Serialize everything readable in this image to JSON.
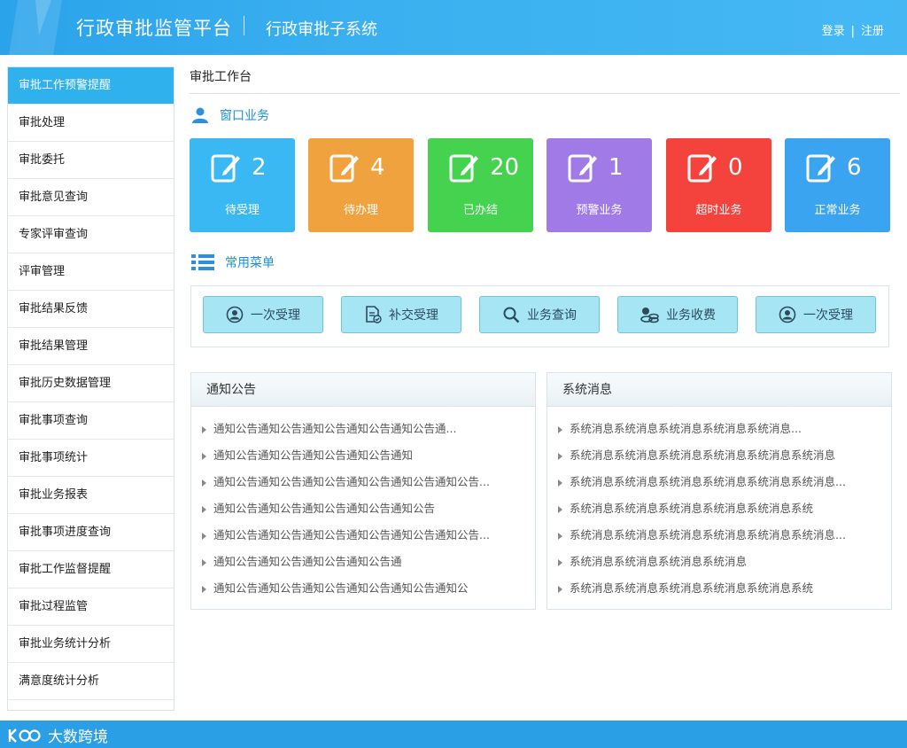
{
  "header": {
    "title": "行政审批监管平台",
    "subtitle": "行政审批子系统",
    "login": "登录",
    "separator": "|",
    "register": "注册"
  },
  "sidebar": {
    "items": [
      {
        "label": "审批工作预警提醒",
        "active": true
      },
      {
        "label": "审批处理"
      },
      {
        "label": "审批委托"
      },
      {
        "label": "审批意见查询"
      },
      {
        "label": "专家评审查询"
      },
      {
        "label": "评审管理"
      },
      {
        "label": "审批结果反馈"
      },
      {
        "label": "审批结果管理"
      },
      {
        "label": "审批历史数据管理"
      },
      {
        "label": "审批事项查询"
      },
      {
        "label": "审批事项统计"
      },
      {
        "label": "审批业务报表"
      },
      {
        "label": "审批事项进度查询"
      },
      {
        "label": "审批工作监督提醒"
      },
      {
        "label": "审批过程监管"
      },
      {
        "label": "审批业务统计分析"
      },
      {
        "label": "满意度统计分析"
      }
    ]
  },
  "main": {
    "page_title": "审批工作台",
    "window_section": {
      "title": "窗口业务",
      "icon": "user-icon",
      "cards": [
        {
          "count": "2",
          "label": "待受理",
          "color": "#39b8f3",
          "icon": "edit-icon"
        },
        {
          "count": "4",
          "label": "待办理",
          "color": "#f0a23f",
          "icon": "edit-icon"
        },
        {
          "count": "20",
          "label": "已办结",
          "color": "#45d34f",
          "icon": "edit-icon"
        },
        {
          "count": "1",
          "label": "预警业务",
          "color": "#a07ae6",
          "icon": "edit-icon"
        },
        {
          "count": "0",
          "label": "超时业务",
          "color": "#f4423c",
          "icon": "edit-icon"
        },
        {
          "count": "6",
          "label": "正常业务",
          "color": "#3aa4f0",
          "icon": "edit-icon"
        }
      ]
    },
    "menu_section": {
      "title": "常用菜单",
      "icon": "list-icon",
      "buttons": [
        {
          "label": "一次受理",
          "icon": "person-circle-icon"
        },
        {
          "label": "补交受理",
          "icon": "document-check-icon"
        },
        {
          "label": "业务查询",
          "icon": "search-icon"
        },
        {
          "label": "业务收费",
          "icon": "coins-icon"
        },
        {
          "label": "一次受理",
          "icon": "person-circle-icon"
        }
      ]
    },
    "notice_panel": {
      "title": "通知公告",
      "items": [
        "通知公告通知公告通知公告通知公告通知公告通...",
        "通知公告通知公告通知公告通知公告通知",
        "通知公告通知公告通知公告通知公告通知公告通知公告...",
        "通知公告通知公告通知公告通知公告通知公告",
        "通知公告通知公告通知公告通知公告通知公告通知公告...",
        "通知公告通知公告通知公告通知公告通",
        "通知公告通知公告通知公告通知公告通知公告通知公"
      ]
    },
    "system_panel": {
      "title": "系统消息",
      "items": [
        "系统消息系统消息系统消息系统消息系统消息...",
        "系统消息系统消息系统消息系统消息系统消息系统消息",
        "系统消息系统消息系统消息系统消息系统消息系统消息...",
        "系统消息系统消息系统消息系统消息系统消息系统",
        "系统消息系统消息系统消息系统消息系统消息系统消息...",
        "系统消息系统消息系统消息系统消息",
        "系统消息系统消息系统消息系统消息系统消息系统"
      ]
    }
  },
  "footer": {
    "watermark": "大数跨境"
  }
}
